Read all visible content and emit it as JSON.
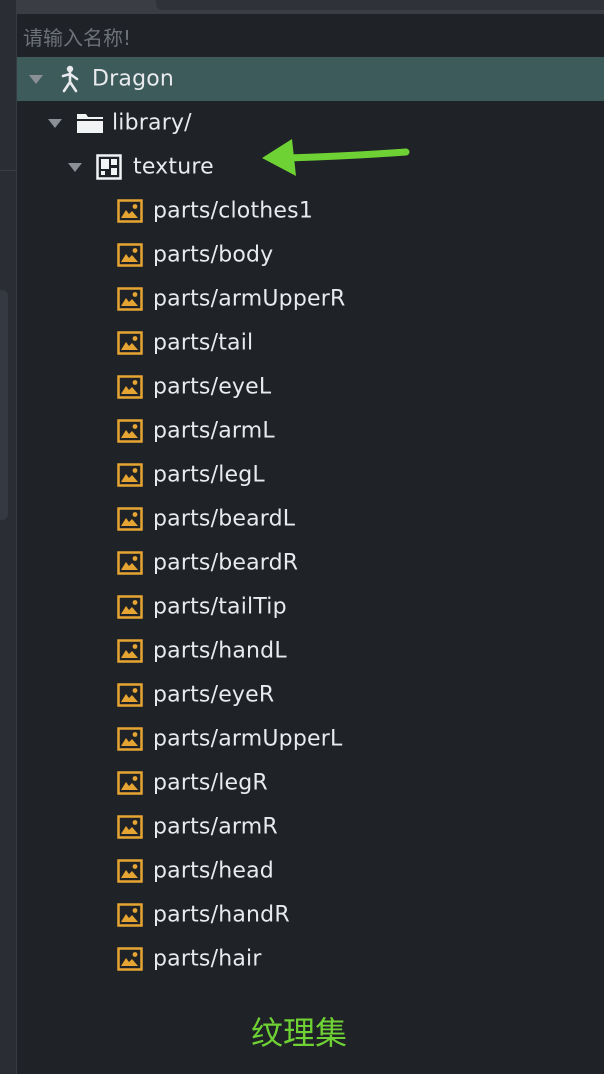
{
  "search": {
    "placeholder": "请输入名称!"
  },
  "tree": {
    "root": {
      "label": "Dragon",
      "icon": "armature-icon"
    },
    "library": {
      "label": "library/",
      "icon": "folder-icon"
    },
    "texture": {
      "label": "texture",
      "icon": "texture-atlas-icon"
    },
    "items": [
      "parts/clothes1",
      "parts/body",
      "parts/armUpperR",
      "parts/tail",
      "parts/eyeL",
      "parts/armL",
      "parts/legL",
      "parts/beardL",
      "parts/beardR",
      "parts/tailTip",
      "parts/handL",
      "parts/eyeR",
      "parts/armUpperL",
      "parts/legR",
      "parts/armR",
      "parts/head",
      "parts/handR",
      "parts/hair"
    ]
  },
  "annotation": {
    "caption": "纹理集"
  },
  "colors": {
    "selected_row": "#3e5b5c",
    "image_icon": "#e6a532",
    "annotation_green": "#6fd234",
    "text": "#e8eaed"
  }
}
